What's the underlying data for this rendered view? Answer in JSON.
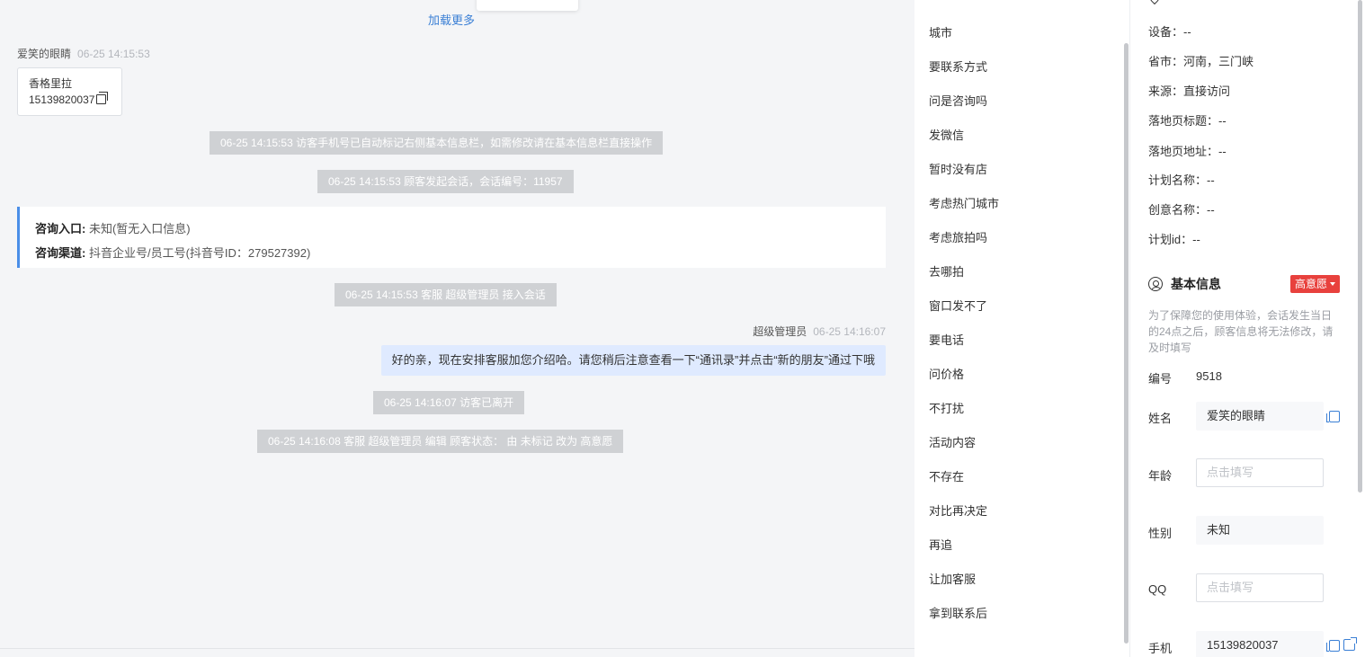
{
  "chat": {
    "load_more": "加载更多",
    "visitor_name": "爱笑的眼睛",
    "visitor_time": "06-25 14:15:53",
    "card_line1": "香格里拉",
    "card_line2": "15139820037",
    "sys1": "06-25 14:15:53 访客手机号已自动标记右侧基本信息栏，如需修改请在基本信息栏直接操作",
    "sys2": "06-25 14:15:53 顾客发起会话，会话编号：11957",
    "entry_label": "咨询入口:",
    "entry_value": "未知(暂无入口信息)",
    "channel_label": "咨询渠道:",
    "channel_value": "抖音企业号/员工号(抖音号ID：279527392)",
    "sys3": "06-25 14:15:53 客服 超级管理员 接入会话",
    "agent_name": "超级管理员",
    "agent_time": "06-25 14:16:07",
    "agent_msg": "好的亲，现在安排客服加您介绍哈。请您稍后注意查看一下“通讯录”并点击“新的朋友”通过下哦",
    "sys4": "06-25 14:16:07 访客已离开",
    "sys5": "06-25 14:16:08 客服 超级管理员 编辑 顾客状态：  由 未标记 改为 高意愿"
  },
  "quick_replies": [
    "城市",
    "要联系方式",
    "问是咨询吗",
    "发微信",
    "暂时没有店",
    "考虑热门城市",
    "考虑旅拍吗",
    "去哪拍",
    "窗口发不了",
    "要电话",
    "问价格",
    "不打扰",
    "活动内容",
    "不存在",
    "对比再决定",
    "再追",
    "让加客服",
    "拿到联系后"
  ],
  "visit_info": {
    "device": "设备：--",
    "province": "省市：河南，三门峡",
    "source": "来源：直接访问",
    "landing_title": "落地页标题：--",
    "landing_url": "落地页地址：--",
    "plan_name": "计划名称：--",
    "creative_name": "创意名称：--",
    "plan_id": "计划id：--"
  },
  "basic_info": {
    "title": "基本信息",
    "badge": "高意愿",
    "notice": "为了保障您的使用体验，会话发生当日的24点之后，顾客信息将无法修改，请及时填写",
    "id_label": "编号",
    "id_value": "9518",
    "name_label": "姓名",
    "name_value": "爱笑的眼睛",
    "age_label": "年龄",
    "age_placeholder": "点击填写",
    "gender_label": "性别",
    "gender_value": "未知",
    "qq_label": "QQ",
    "qq_placeholder": "点击填写",
    "phone_label": "手机",
    "phone_value": "15139820037"
  },
  "colors": {
    "accent": "#3a7fd5",
    "badge": "#e8413d",
    "bubble": "#dfeaff",
    "system": "#cfd1d4"
  }
}
